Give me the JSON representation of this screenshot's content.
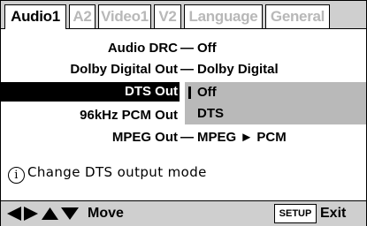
{
  "tabs": [
    {
      "label": "Audio1",
      "active": true
    },
    {
      "label": "A2",
      "active": false
    },
    {
      "label": "Video1",
      "active": false
    },
    {
      "label": "V2",
      "active": false
    },
    {
      "label": "Language",
      "active": false
    },
    {
      "label": "General",
      "active": false
    }
  ],
  "menu": {
    "audio_drc": {
      "label": "Audio DRC",
      "separator": "—",
      "value": "Off"
    },
    "dolby_digital_out": {
      "label": "Dolby Digital Out",
      "separator": "—",
      "value": "Dolby Digital"
    },
    "dts_out": {
      "label": "DTS Out"
    },
    "pcm_96khz_out": {
      "label": "96kHz PCM Out"
    },
    "mpeg_out": {
      "label": "MPEG Out",
      "separator": "—",
      "value": "MPEG ► PCM"
    }
  },
  "dts_popup": {
    "options": [
      "Off",
      "DTS"
    ],
    "selected": "Off"
  },
  "help": {
    "icon": "info-icon",
    "icon_glyph": "i",
    "text": "Change DTS output mode"
  },
  "bottom_bar": {
    "nav_icons": [
      "left-arrow-icon",
      "right-arrow-icon",
      "up-arrow-icon",
      "down-arrow-icon"
    ],
    "move_label": "Move",
    "setup_label": "SETUP",
    "exit_label": "Exit"
  },
  "colors": {
    "bar_gray": "#cfcfcf",
    "popup_gray": "#b9b9b9",
    "inactive_tab_text": "#b8b8b8",
    "highlight": "#000000"
  }
}
